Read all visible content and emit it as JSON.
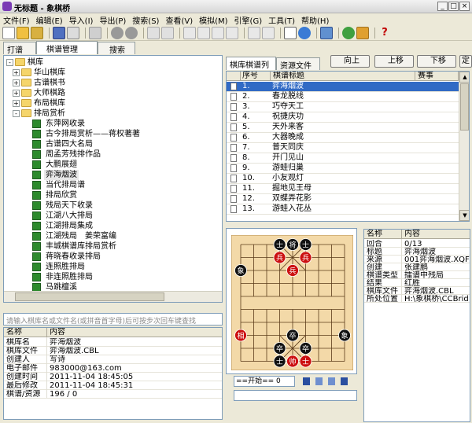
{
  "window": {
    "title": "无标题 - 象棋桥",
    "min": "_",
    "max": "□",
    "close": "×"
  },
  "menu": [
    "文件(F)",
    "编辑(E)",
    "导入(I)",
    "导出(P)",
    "搜索(S)",
    "查看(V)",
    "模拟(M)",
    "引擎(G)",
    "工具(T)",
    "帮助(H)"
  ],
  "left_tabs": [
    "打谱",
    "棋谱管理",
    "搜索"
  ],
  "tree": {
    "root": "棋库",
    "top_items": [
      "华山棋库",
      "古谱棋书",
      "大师棋路",
      "布局棋库",
      "排局赏析"
    ],
    "sub_items": [
      "东萍网收录",
      "古今排局赏析——蒋权著著",
      "古谱四大名局",
      "周孟芳残排作品",
      "大鹏展翅",
      "弈海烟波",
      "当代排局谱",
      "排局欣赏",
      "残局天下收录",
      "江湖八大排局",
      "江湖排局集成",
      "江湖残局　姜荣富编",
      "丰城棋谱库排局赏析",
      "蒋晓春收录排局",
      "连照胜排局",
      "非连照胜排局",
      "马跳檀溪"
    ],
    "bottom_items": [
      "杯赛风云",
      "棋研探秘",
      "象棋排"
    ]
  },
  "search_placeholder": "请输入棋库名或文件名(或拼音首字母)后可按步次回车键查找",
  "lib_info": {
    "headers": [
      "名称",
      "内容"
    ],
    "rows": [
      [
        "棋库名",
        "弈海烟波"
      ],
      [
        "棋库文件",
        "弈海烟波.CBL"
      ],
      [
        "创建人",
        "写诗"
      ],
      [
        "电子邮件",
        "983000@163.com"
      ],
      [
        "创建时间",
        "2011-11-04 18:45:05"
      ],
      [
        "最后修改",
        "2011-11-04 18:45:31"
      ],
      [
        "棋谱/资源",
        "196 / 0"
      ]
    ]
  },
  "right_tabs": [
    "棋库棋谱列表",
    "资源文件"
  ],
  "right_buttons": [
    "向上",
    "上移",
    "下移",
    "定"
  ],
  "game_list": {
    "headers": [
      "序号",
      "棋谱标题",
      "赛事"
    ],
    "rows": [
      [
        "1.",
        "弈海烟波"
      ],
      [
        "2.",
        "春龙脱线"
      ],
      [
        "3.",
        "巧夺天工"
      ],
      [
        "4.",
        "祝捷庆功"
      ],
      [
        "5.",
        "天外来客"
      ],
      [
        "6.",
        "大器晚成"
      ],
      [
        "7.",
        "普天同庆"
      ],
      [
        "8.",
        "开门见山"
      ],
      [
        "9.",
        "游蛙归巢"
      ],
      [
        "10.",
        "小友观灯"
      ],
      [
        "11.",
        "掘地见王母"
      ],
      [
        "12.",
        "双蝶弄花影"
      ],
      [
        "13.",
        "游蛙入花丛"
      ]
    ]
  },
  "board_pieces": [
    {
      "t": "士",
      "c": "black",
      "col": 3,
      "row": 0
    },
    {
      "t": "将",
      "c": "black",
      "col": 4,
      "row": 0
    },
    {
      "t": "士",
      "c": "black",
      "col": 5,
      "row": 0
    },
    {
      "t": "兵",
      "c": "red",
      "col": 3,
      "row": 1
    },
    {
      "t": "兵",
      "c": "red",
      "col": 5,
      "row": 1
    },
    {
      "t": "兵",
      "c": "red",
      "col": 4,
      "row": 2
    },
    {
      "t": "象",
      "c": "black",
      "col": 0,
      "row": 2
    },
    {
      "t": "相",
      "c": "red",
      "col": 0,
      "row": 7
    },
    {
      "t": "卒",
      "c": "black",
      "col": 4,
      "row": 7
    },
    {
      "t": "卒",
      "c": "black",
      "col": 3,
      "row": 8
    },
    {
      "t": "卒",
      "c": "black",
      "col": 5,
      "row": 8
    },
    {
      "t": "象",
      "c": "black",
      "col": 8,
      "row": 7
    },
    {
      "t": "士",
      "c": "black",
      "col": 3,
      "row": 9
    },
    {
      "t": "帅",
      "c": "red",
      "col": 4,
      "row": 9
    },
    {
      "t": "士",
      "c": "red",
      "col": 5,
      "row": 9
    }
  ],
  "move_select": "==开始== 0",
  "game_info": {
    "headers": [
      "名称",
      "内容"
    ],
    "rows": [
      [
        "回合",
        "0/13"
      ],
      [
        "标题",
        "弈海烟波"
      ],
      [
        "来源",
        "001弈海烟波.XQF"
      ],
      [
        "创建",
        "张建鹏"
      ],
      [
        "棋谱类型",
        "擂谱中残局"
      ],
      [
        "结果",
        "红胜"
      ],
      [
        "棋库文件",
        "弈海烟波.CBL"
      ],
      [
        "所处位置",
        "H:\\象棋桥\\CCBrid"
      ]
    ]
  },
  "colors": {
    "selection": "#316ac5",
    "gridline": "#aca899",
    "red": "#cc1010",
    "black": "#111111"
  }
}
